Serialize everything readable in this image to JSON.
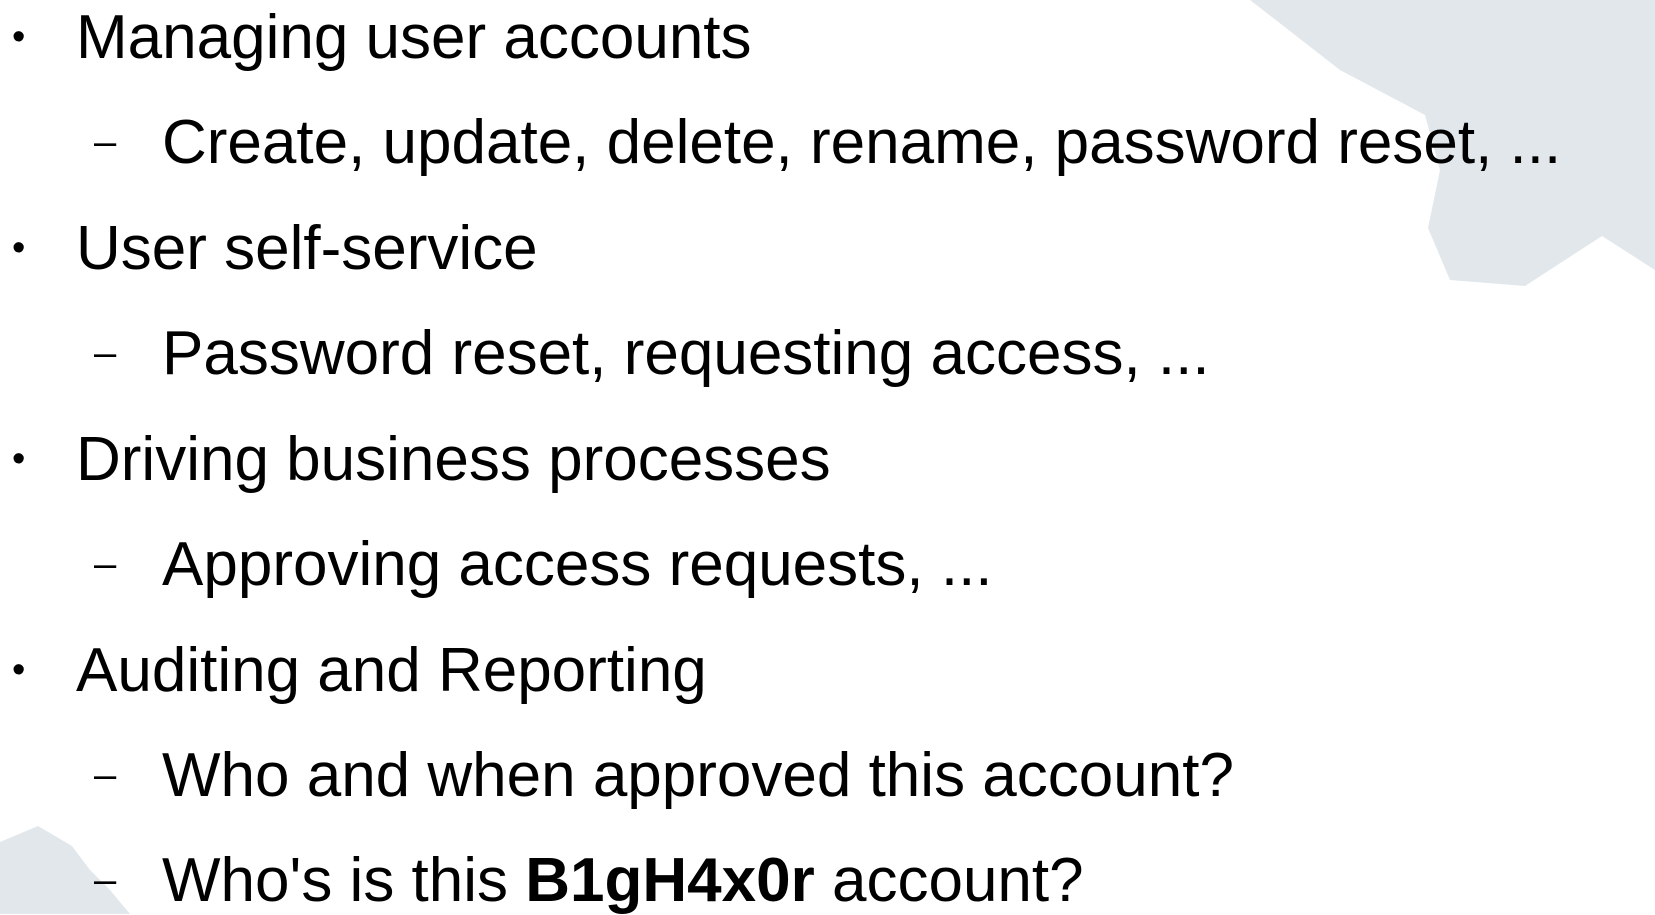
{
  "colors": {
    "background": "#ffffff",
    "decoration": "#e1e7ea",
    "text": "#000000"
  },
  "bullet_glyph": "•",
  "dash_glyph": "–",
  "items": [
    {
      "text": "Managing user accounts",
      "sub": [
        "Create, update, delete, rename, password reset, ..."
      ]
    },
    {
      "text": "User self-service",
      "sub": [
        "Password reset, requesting access, ..."
      ]
    },
    {
      "text": "Driving business processes",
      "sub": [
        "Approving access requests, ..."
      ]
    },
    {
      "text": "Auditing and Reporting",
      "sub": [
        "Who and when approved this account?",
        {
          "before": "Who's is this ",
          "bold": "B1gH4x0r",
          "after": " account?"
        }
      ]
    }
  ]
}
